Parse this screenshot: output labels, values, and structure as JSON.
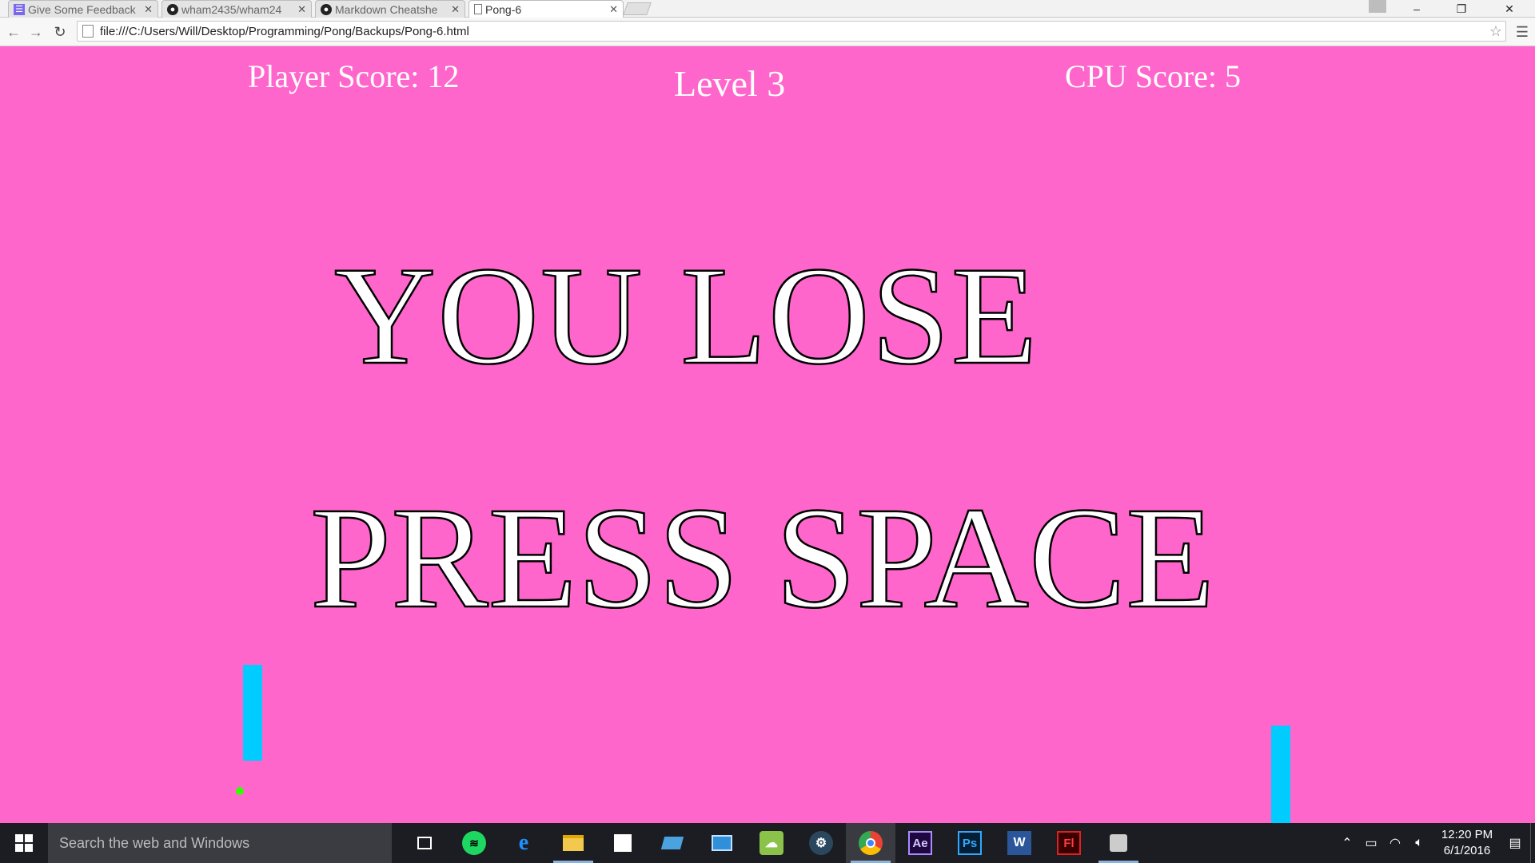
{
  "browser": {
    "tabs": [
      {
        "title": "Give Some Feedback",
        "icon": "form-icon",
        "active": false
      },
      {
        "title": "wham2435/wham24",
        "icon": "github-icon",
        "active": false
      },
      {
        "title": "Markdown Cheatshe",
        "icon": "github-icon",
        "active": false
      },
      {
        "title": "Pong-6",
        "icon": "page-icon",
        "active": true
      }
    ],
    "address": "file:///C:/Users/Will/Desktop/Programming/Pong/Backups/Pong-6.html",
    "window_controls": {
      "minimize": "–",
      "restore": "❐",
      "close": "✕"
    }
  },
  "game": {
    "player_score": "Player Score: 12",
    "level": "Level 3",
    "cpu_score": "CPU Score: 5",
    "message_line1": "YOU LOSE",
    "message_line2": "PRESS SPACE",
    "colors": {
      "background": "#ff66cc",
      "paddle": "#00ccff",
      "ball": "#33ff00",
      "text": "#ffffff",
      "outline": "#000000"
    }
  },
  "taskbar": {
    "search_placeholder": "Search the web and Windows",
    "apps": [
      "task-view-icon",
      "spotify-icon",
      "edge-icon",
      "file-explorer-icon",
      "store-icon",
      "laptop-app-icon",
      "outlook-app-icon",
      "cloud-app-icon",
      "steam-icon",
      "chrome-icon",
      "after-effects-icon",
      "photoshop-icon",
      "word-icon",
      "flash-icon",
      "game-app-icon"
    ],
    "app_labels": {
      "after_effects": "Ae",
      "photoshop": "Ps",
      "word": "W",
      "flash": "Fl"
    },
    "time": "12:20 PM",
    "date": "6/1/2016"
  }
}
